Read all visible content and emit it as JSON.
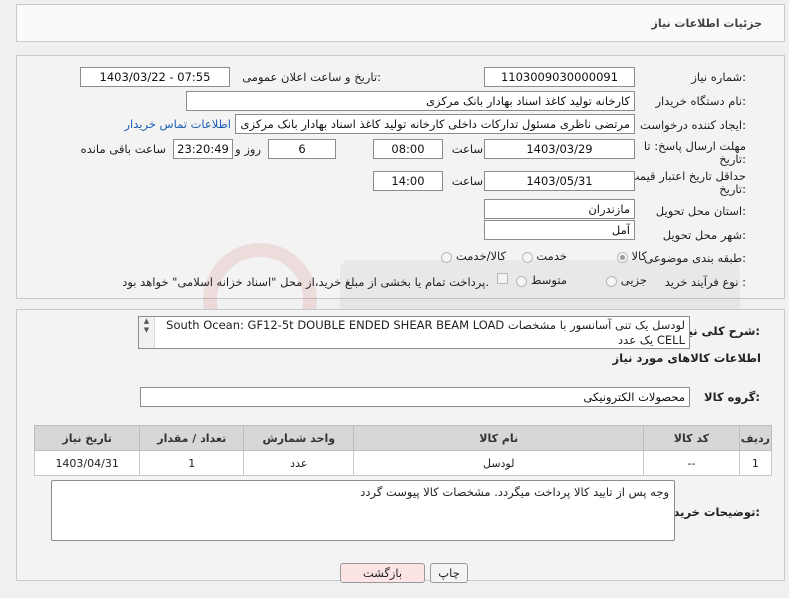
{
  "header": {
    "title": "جزئیات اطلاعات نیاز"
  },
  "form": {
    "need_number_label": "شماره نیاز:",
    "need_number": "1103009030000091",
    "announce_label": "تاریخ و ساعت اعلان عمومی:",
    "announce_value": "1403/03/22 - 07:55",
    "buyer_label": "نام دستگاه خریدار:",
    "buyer_value": "کارخانه تولید کاغذ اسناد بهادار بانک مرکزی",
    "creator_label": "ایجاد کننده درخواست:",
    "creator_value": "مرتضی ناظری مسئول تدارکات داخلی کارخانه تولید کاغذ اسناد بهادار بانک مرکزی",
    "contact_link": "اطلاعات تماس خریدار",
    "deadline_label_1": "مهلت ارسال پاسخ: تا",
    "deadline_label_2": "تاریخ:",
    "deadline_date": "1403/03/29",
    "time_label": "ساعت",
    "deadline_time": "08:00",
    "days_value": "6",
    "days_label": "روز و",
    "remaining_time": "23:20:49",
    "remaining_label": "ساعت باقی مانده",
    "validity_label_1": "حداقل تاریخ اعتبار قیمت: تا",
    "validity_label_2": "تاریخ:",
    "validity_date": "1403/05/31",
    "validity_time": "14:00",
    "province_label": "استان محل تحویل:",
    "province_value": "مازندران",
    "city_label": "شهر محل تحویل:",
    "city_value": "آمل",
    "category_label": "طبقه بندی موضوعی:",
    "category_options": [
      "کالا",
      "خدمت",
      "کالا/خدمت"
    ],
    "category_selected": "کالا",
    "process_label": "نوع فرآیند خرید :",
    "process_options": [
      "جزیی",
      "متوسط"
    ],
    "payment_note": "پرداخت تمام یا بخشی از مبلغ خرید،از محل \"اسناد خزانه اسلامی\" خواهد بود."
  },
  "description": {
    "label": "شرح کلی نیاز:",
    "text": "لودسل یک تنی آسانسور با مشخصات South Ocean: GF12-5t DOUBLE ENDED SHEAR BEAM LOAD CELL یک عدد"
  },
  "goods": {
    "section_title": "اطلاعات کالاهای مورد نیاز",
    "group_label": "گروه کالا:",
    "group_value": "محصولات الکترونیکی",
    "columns": [
      "ردیف",
      "کد کالا",
      "نام کالا",
      "واحد شمارش",
      "تعداد / مقدار",
      "تاریخ نیاز"
    ],
    "rows": [
      {
        "row": "1",
        "code": "--",
        "name": "لودسل",
        "unit": "عدد",
        "qty": "1",
        "date": "1403/04/31"
      }
    ]
  },
  "buyer_notes": {
    "label": "توضیحات خریدار:",
    "text": "وجه پس از تایید کالا پرداخت میگردد. مشخصات کالا پیوست گردد"
  },
  "buttons": {
    "print": "چاپ",
    "back": "بازگشت"
  },
  "colors": {
    "back_button_bg": "#fde4e4",
    "print_button_bg": "#f4f4f4",
    "link": "#1a5fb4"
  }
}
